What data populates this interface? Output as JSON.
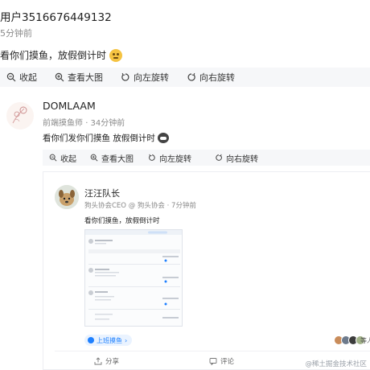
{
  "outer_post": {
    "user": "用户3516676449132",
    "time": "5分钟前",
    "content": "看你们摸鱼，放假倒计时",
    "emoji": "thinking-face-emoji"
  },
  "toolbar": {
    "collapse": "收起",
    "view_large": "查看大图",
    "rotate_left": "向左旋转",
    "rotate_right": "向右旋转"
  },
  "forwarded_post": {
    "author": "DOMLAAM",
    "role": "前端摸鱼师",
    "time": "34分钟前",
    "content": "看你们发你们摸鱼 放假倒计时",
    "emoji": "cat-emoji"
  },
  "embedded_post": {
    "author": "汪汪队长",
    "role": "狗头协会CEO",
    "org": "狗头协会",
    "time": "7分钟前",
    "content": "看你们摸鱼，放假倒计时",
    "topic_tag": "上班摸鱼",
    "likers_text": "等人",
    "actions": {
      "share": "分享",
      "comment": "评论"
    }
  },
  "watermark": "@稀土掘金技术社区",
  "colors": {
    "accent": "#1e80ff",
    "toolbar_bg": "#f6f7f9",
    "muted": "#8a8a8a"
  }
}
